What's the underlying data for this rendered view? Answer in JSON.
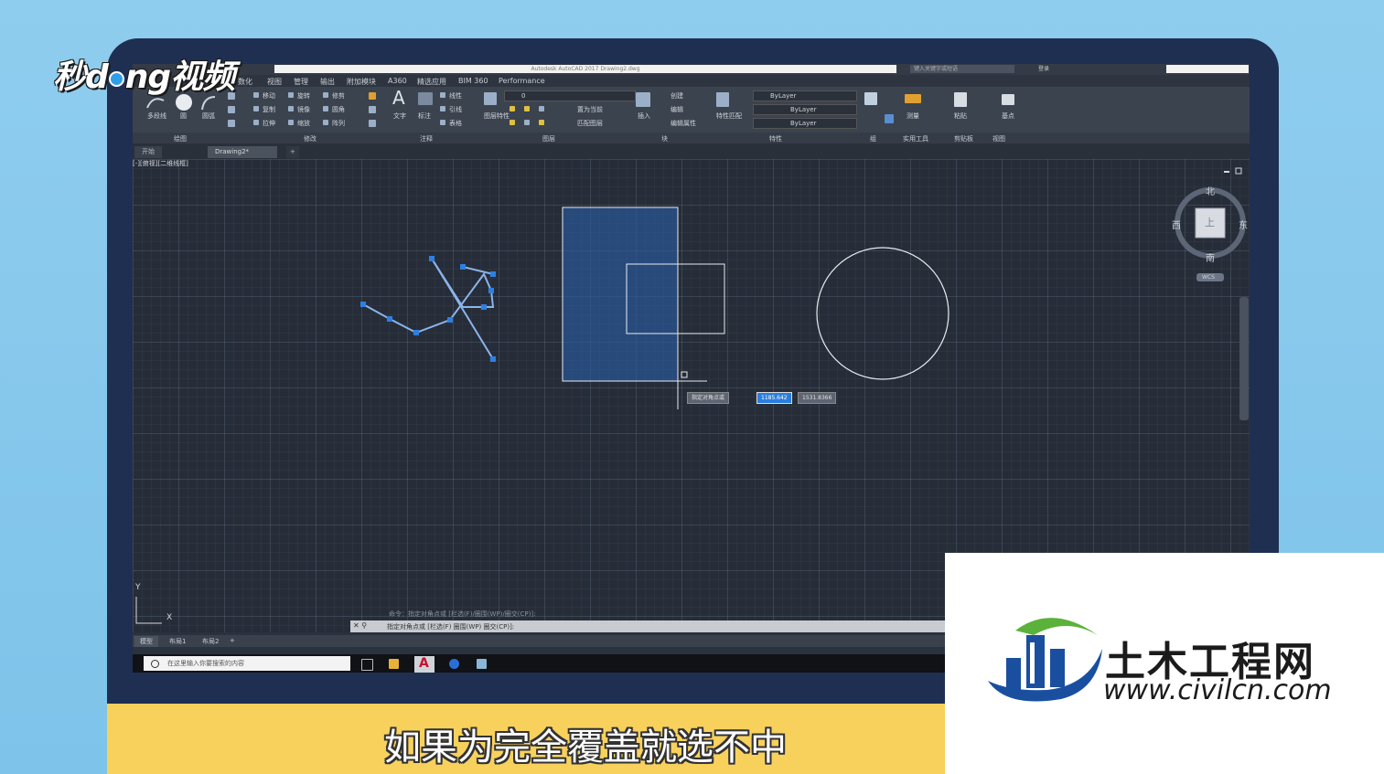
{
  "watermark": {
    "text_a": "秒d",
    "text_b": "ng视频"
  },
  "titlebar": {
    "doc_title": "Autodesk AutoCAD 2017    Drawing2.dwg",
    "search_placeholder": "键入关键字或短语",
    "user": "登录"
  },
  "menu_tabs": [
    "数化",
    "视图",
    "管理",
    "输出",
    "附加模块",
    "A360",
    "精选应用",
    "BIM 360",
    "Performance"
  ],
  "ribbon": {
    "draw_tools": [
      "多段线",
      "圆",
      "圆弧"
    ],
    "modify_tools": [
      "移动",
      "旋转",
      "修剪",
      "复制",
      "镜像",
      "圆角",
      "拉伸",
      "缩放",
      "阵列"
    ],
    "annotation": {
      "text": "文字",
      "dim": "标注",
      "linear": "线性",
      "leader": "引线",
      "table": "表格"
    },
    "layers": {
      "layer_props": "图层特性",
      "current_layer": "0",
      "match": "置为当前",
      "match_layer": "匹配图层"
    },
    "block": {
      "insert": "插入",
      "create": "创建",
      "edit": "编辑",
      "edit_attr": "编辑属性"
    },
    "properties": {
      "match_props": "特性匹配",
      "color": "ByLayer",
      "linetype": "ByLayer",
      "lineweight": "ByLayer"
    },
    "groups": "组",
    "utilities": {
      "measure": "测量"
    },
    "clipboard": {
      "paste": "粘贴"
    },
    "view": {
      "base": "基点"
    },
    "panel_labels": [
      "绘图",
      "修改",
      "注释",
      "图层",
      "块",
      "特性",
      "组",
      "实用工具",
      "剪贴板",
      "视图"
    ]
  },
  "file_tabs": {
    "start": "开始",
    "drawing": "Drawing2*",
    "add": "+"
  },
  "viewport": {
    "label": "[-][俯视][二维线框]",
    "viewcube": {
      "north": "北",
      "south": "南",
      "west": "西",
      "east": "东",
      "top": "上",
      "wcs": "WCS"
    },
    "prompt": "指定对角点或",
    "coord_x": "1185.642",
    "coord_y": "1531.8366",
    "ucs_x": "X",
    "ucs_y": "Y"
  },
  "command": {
    "history": "命令：指定对角点或 [栏选(F)/圈围(WP)/圈交(CP)]:",
    "current": "指定对角点或 [栏选(F) 圈围(WP) 圈交(CP)]:"
  },
  "layout_tabs": [
    "模型",
    "布局1",
    "布局2",
    "+"
  ],
  "taskbar": {
    "search_placeholder": "在这里输入你要搜索的内容"
  },
  "subtitle": "如果为完全覆盖就选不中",
  "logo": {
    "name": "土木工程网",
    "url": "www.civilcn.com"
  },
  "colors": {
    "selection_fill": "#2a5aa0",
    "grip": "#2f7fe0",
    "subtitle_bar": "#f8d15d",
    "background": "#8fcdee"
  }
}
